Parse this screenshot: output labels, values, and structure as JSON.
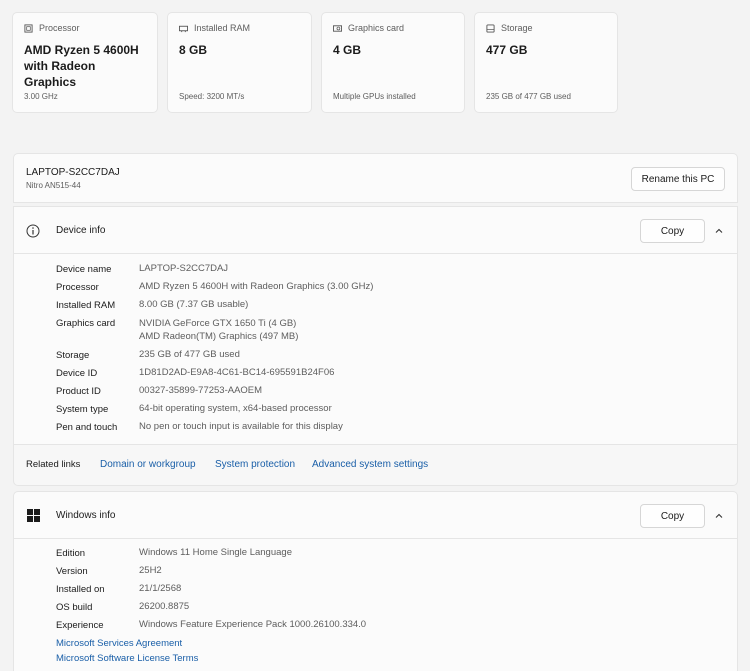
{
  "cards": [
    {
      "icon": "processor-icon",
      "title": "Processor",
      "value": "AMD Ryzen 5 4600H with Radeon Graphics",
      "sub": "3.00 GHz"
    },
    {
      "icon": "ram-icon",
      "title": "Installed RAM",
      "value": "8 GB",
      "sub": "Speed: 3200 MT/s"
    },
    {
      "icon": "graphics-card-icon",
      "title": "Graphics card",
      "value": "4 GB",
      "sub": "Multiple GPUs installed"
    },
    {
      "icon": "storage-icon",
      "title": "Storage",
      "value": "477 GB",
      "sub": "235 GB of 477 GB used"
    }
  ],
  "pc": {
    "name": "LAPTOP-S2CC7DAJ",
    "model": "Nitro AN515-44",
    "rename_label": "Rename this PC"
  },
  "device_info": {
    "title": "Device info",
    "copy_label": "Copy",
    "rows": [
      {
        "label": "Device name",
        "value": "LAPTOP-S2CC7DAJ"
      },
      {
        "label": "Processor",
        "value": "AMD Ryzen 5 4600H with Radeon Graphics (3.00 GHz)"
      },
      {
        "label": "Installed RAM",
        "value": "8.00 GB (7.37 GB usable)"
      },
      {
        "label": "Graphics card",
        "value": "NVIDIA GeForce GTX 1650 Ti (4 GB)",
        "value2": "AMD Radeon(TM) Graphics (497 MB)"
      },
      {
        "label": "Storage",
        "value": "235 GB of 477 GB used"
      },
      {
        "label": "Device ID",
        "value": "1D81D2AD-E9A8-4C61-BC14-695591B24F06"
      },
      {
        "label": "Product ID",
        "value": "00327-35899-77253-AAOEM"
      },
      {
        "label": "System type",
        "value": "64-bit operating system, x64-based processor"
      },
      {
        "label": "Pen and touch",
        "value": "No pen or touch input is available for this display"
      }
    ]
  },
  "related": {
    "label": "Related links",
    "links": [
      "Domain or workgroup",
      "System protection",
      "Advanced system settings"
    ]
  },
  "windows_info": {
    "title": "Windows info",
    "copy_label": "Copy",
    "rows": [
      {
        "label": "Edition",
        "value": "Windows 11 Home Single Language"
      },
      {
        "label": "Version",
        "value": "25H2"
      },
      {
        "label": "Installed on",
        "value": "21/1/2568"
      },
      {
        "label": "OS build",
        "value": "26200.8875"
      },
      {
        "label": "Experience",
        "value": "Windows Feature Experience Pack 1000.26100.334.0"
      }
    ],
    "links": [
      "Microsoft Services Agreement",
      "Microsoft Software License Terms"
    ]
  },
  "colors": {
    "link": "#1a5fa8",
    "panel": "#fbfbfb",
    "background": "#f3f3f3"
  }
}
